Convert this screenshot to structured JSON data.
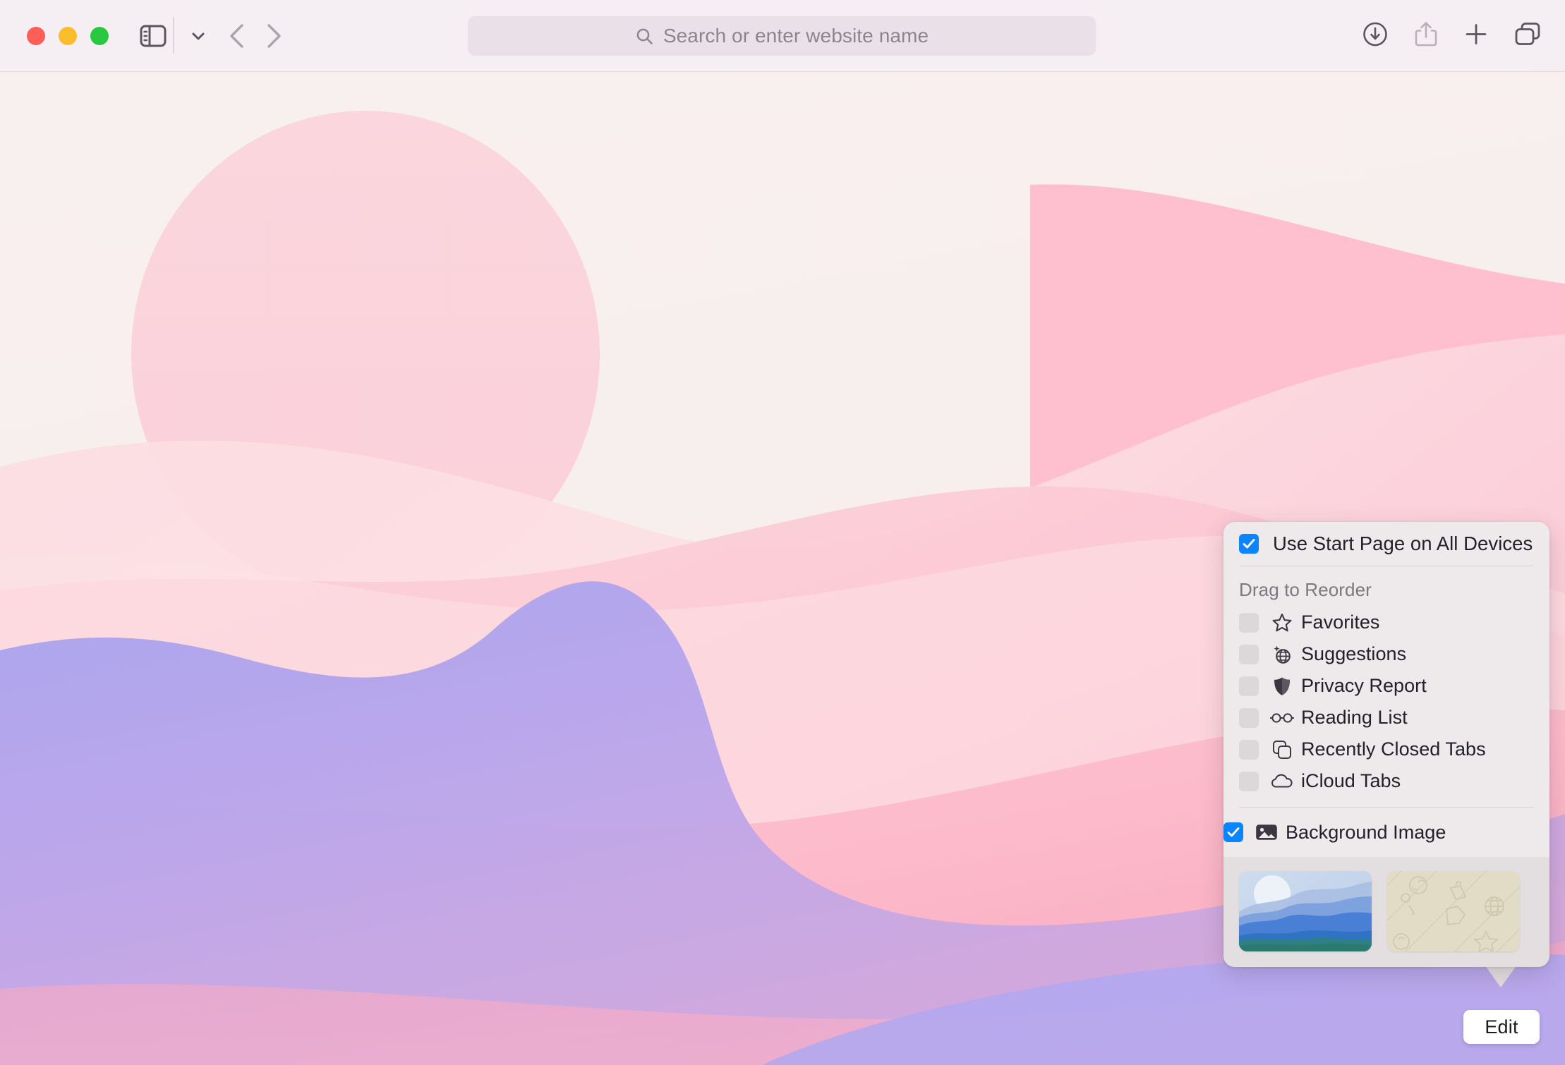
{
  "window": {
    "traffic_lights": [
      {
        "name": "close",
        "color": "#ff5f57"
      },
      {
        "name": "minimize",
        "color": "#fcbd2d"
      },
      {
        "name": "zoom",
        "color": "#28c840"
      }
    ]
  },
  "toolbar": {
    "sidebar_icon": "sidebar-icon",
    "sidebar_chevron_icon": "chevron-down-icon",
    "back_icon": "chevron-left-icon",
    "forward_icon": "chevron-right-icon",
    "address_bar": {
      "value": "",
      "placeholder": "Search or enter website name",
      "search_icon": "search-icon"
    },
    "right_items": [
      {
        "name": "downloads-button",
        "icon": "download-circle-icon"
      },
      {
        "name": "share-button",
        "icon": "share-icon"
      },
      {
        "name": "new-tab-button",
        "icon": "plus-icon"
      },
      {
        "name": "tab-overview-button",
        "icon": "tab-overview-icon"
      }
    ]
  },
  "popover": {
    "start_page_sync": {
      "label": "Use Start Page on All Devices",
      "checked": true
    },
    "drag_header": "Drag to Reorder",
    "sections": [
      {
        "name": "Favorites",
        "icon": "star-icon",
        "checked": false
      },
      {
        "name": "Suggestions",
        "icon": "sparkle-globe-icon",
        "checked": false
      },
      {
        "name": "Privacy Report",
        "icon": "shield-icon",
        "checked": false
      },
      {
        "name": "Reading List",
        "icon": "glasses-icon",
        "checked": false
      },
      {
        "name": "Recently Closed Tabs",
        "icon": "stacked-squares-icon",
        "checked": false
      },
      {
        "name": "iCloud Tabs",
        "icon": "cloud-icon",
        "checked": false
      }
    ],
    "background_image": {
      "label": "Background Image",
      "icon": "photo-icon",
      "checked": true
    },
    "thumbnails": [
      {
        "name": "mountains-wallpaper-thumbnail",
        "selected": false
      },
      {
        "name": "beige-pattern-wallpaper-thumbnail",
        "selected": false
      }
    ]
  },
  "edit_button": {
    "label": "Edit"
  },
  "colors": {
    "accent": "#0a84ff",
    "toolbar_bg": "#f5eff3",
    "popover_bg": "#eeeaec",
    "thumb_strip_bg": "#e3dfe1",
    "label_text": "#22202a",
    "muted_text": "#7c7880",
    "checkbox_off": "#dcd8da"
  }
}
